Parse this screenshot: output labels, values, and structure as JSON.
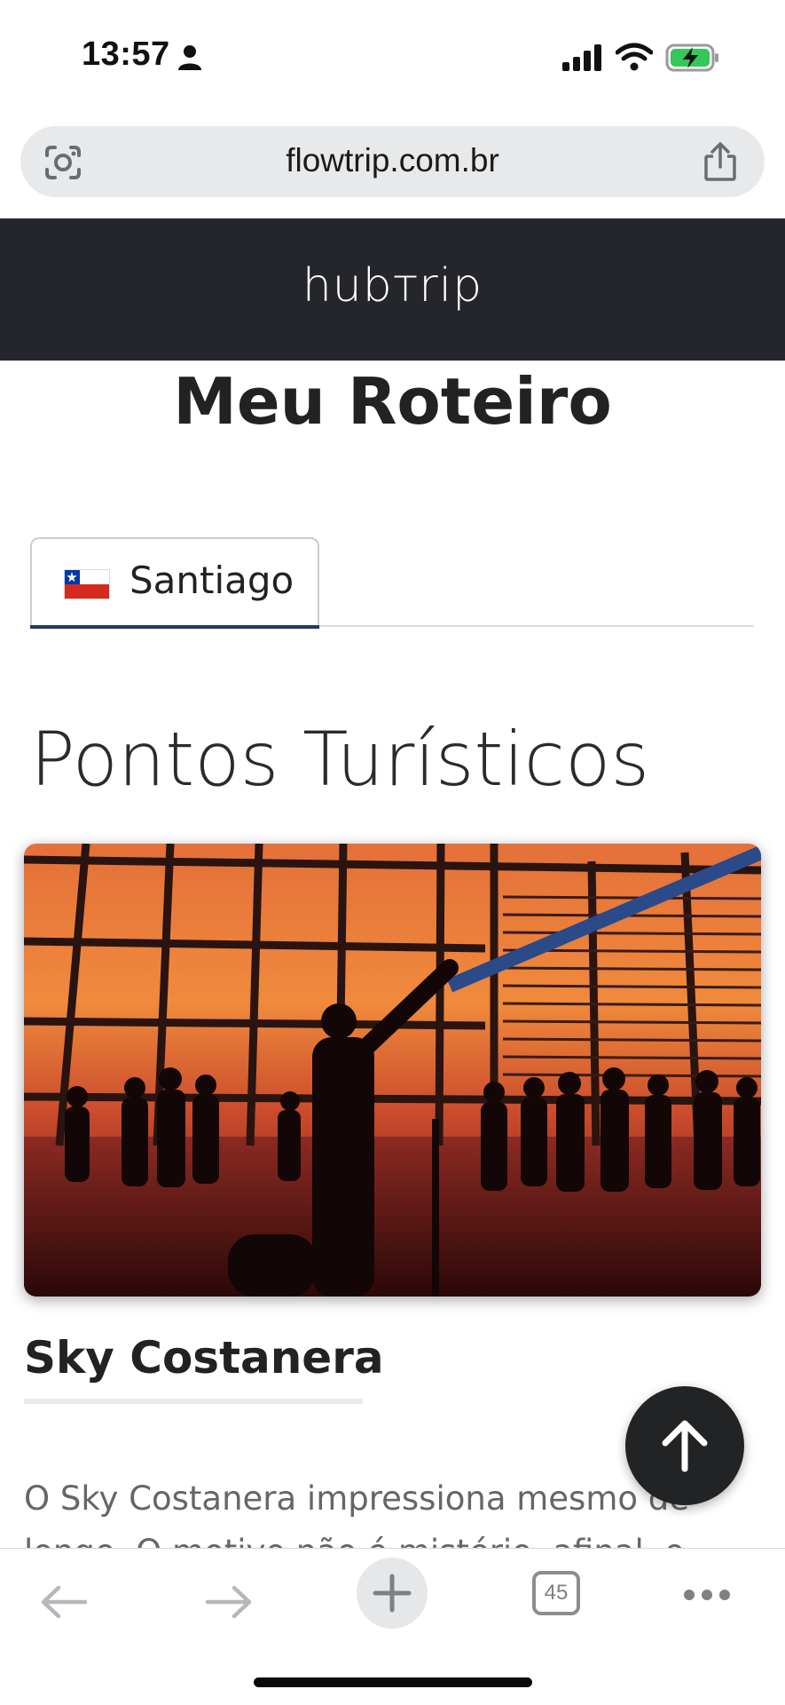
{
  "status_bar": {
    "time": "13:57",
    "icons": [
      "person-icon",
      "signal-icon",
      "wifi-icon",
      "battery-charging-icon"
    ]
  },
  "browser": {
    "url": "flowtrip.com.br",
    "icons": [
      "lens-icon",
      "share-icon"
    ]
  },
  "site": {
    "logo": "hubтrip"
  },
  "page": {
    "title": "Meu Roteiro",
    "tabs": [
      {
        "label": "Santiago",
        "flag": "chile-flag-icon",
        "active": true
      }
    ],
    "section_title": "Pontos Turísticos",
    "attraction": {
      "title": "Sky Costanera",
      "description": "O Sky Costanera impressiona mesmo de longe. O motivo não é mistério, afinal, o",
      "image": "sunset-observation-deck-photo"
    }
  },
  "toolbar": {
    "tab_count": "45",
    "icons": [
      "back-arrow-icon",
      "forward-arrow-icon",
      "plus-icon",
      "tabs-icon",
      "more-icon"
    ]
  },
  "colors": {
    "header_bg": "#24262b",
    "tab_accent": "#1f3a68",
    "scroll_button_bg": "#222325"
  }
}
